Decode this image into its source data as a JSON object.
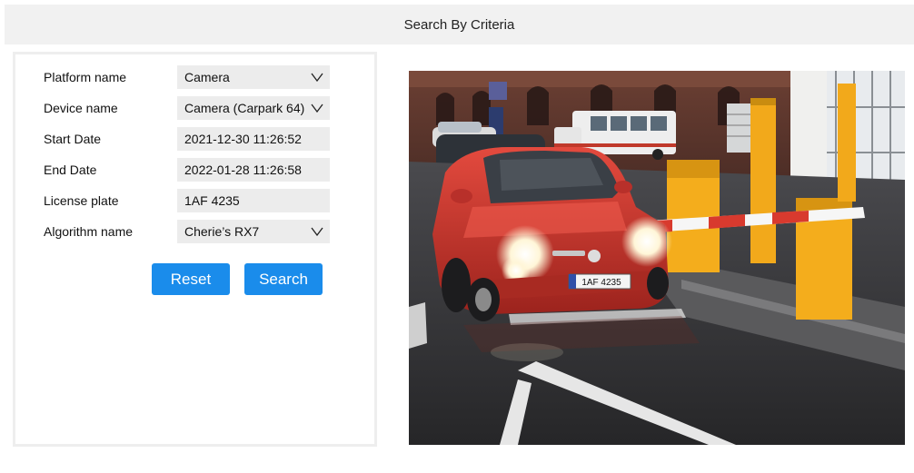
{
  "header": {
    "title": "Search By Criteria"
  },
  "form": {
    "fields": [
      {
        "label": "Platform name",
        "value": "Camera",
        "type": "select"
      },
      {
        "label": "Device name",
        "value": "Camera (Carpark 64)",
        "type": "select"
      },
      {
        "label": "Start Date",
        "value": "2021-12-30 11:26:52",
        "type": "text"
      },
      {
        "label": "End Date",
        "value": "2022-01-28 11:26:58",
        "type": "text"
      },
      {
        "label": "License plate",
        "value": "1AF 4235",
        "type": "text"
      },
      {
        "label": "Algorithm name",
        "value": "Cherie’s RX7",
        "type": "select"
      }
    ],
    "reset_label": "Reset",
    "search_label": "Search"
  },
  "preview": {
    "plate_text": "1AF 4235"
  },
  "colors": {
    "accent": "#1a8ceb",
    "header_bg": "#f1f1f1",
    "field_bg": "#ececec"
  }
}
